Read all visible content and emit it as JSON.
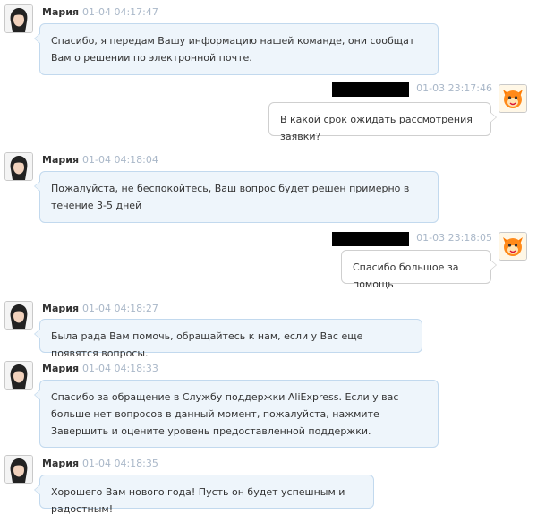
{
  "messages": [
    {
      "sender": "Мария",
      "time": "01-04 04:17:47",
      "text": "Спасибо, я передам Вашу информацию нашей команде, они сообщат Вам о решении по электронной почте."
    },
    {
      "sender": "",
      "time": "01-03 23:17:46",
      "text": "В какой срок ожидать рассмотрения заявки?"
    },
    {
      "sender": "Мария",
      "time": "01-04 04:18:04",
      "text": "Пожалуйста, не беспокойтесь, Ваш вопрос будет решен примерно в течение 3-5 дней"
    },
    {
      "sender": "",
      "time": "01-03 23:18:05",
      "text": "Спасибо большое за помощь"
    },
    {
      "sender": "Мария",
      "time": "01-04 04:18:27",
      "text": "Была рада Вам помочь, обращайтесь к нам, если у Вас еще появятся вопросы."
    },
    {
      "sender": "Мария",
      "time": "01-04 04:18:33",
      "text": "Спасибо за обращение в Службу поддержки AliExpress. Если у вас больше нет вопросов в данный момент, пожалуйста, нажмите Завершить и оцените уровень предоставленной поддержки."
    },
    {
      "sender": "Мария",
      "time": "01-04 04:18:35",
      "text": "Хорошего Вам нового года! Пусть он будет успешным и радостным!"
    }
  ],
  "icons": {
    "agent_avatar": "agent-photo-icon",
    "user_avatar": "orange-mascot-icon"
  },
  "colors": {
    "agent_bubble": "#eef5fb",
    "agent_border": "#c2d9ee",
    "user_bubble": "#ffffff",
    "timestamp": "#a9b7c8"
  }
}
